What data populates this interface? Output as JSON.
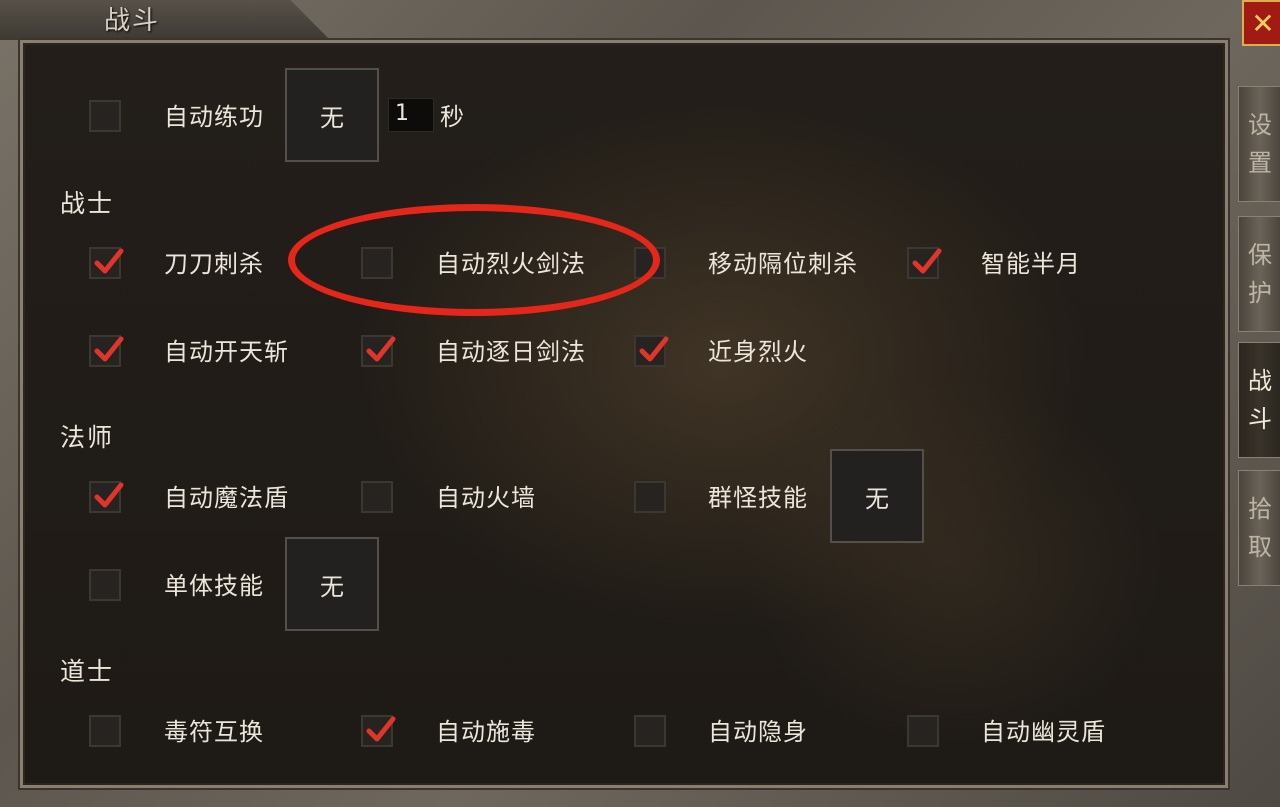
{
  "window": {
    "title": "战斗",
    "close_icon": "✕"
  },
  "side_tabs": [
    {
      "label": "设置",
      "chars": [
        "设",
        "置"
      ],
      "active": false
    },
    {
      "label": "保护",
      "chars": [
        "保",
        "护"
      ],
      "active": false
    },
    {
      "label": "战斗",
      "chars": [
        "战",
        "斗"
      ],
      "active": true
    },
    {
      "label": "拾取",
      "chars": [
        "拾",
        "取"
      ],
      "active": false
    }
  ],
  "auto_practice": {
    "label": "自动练功",
    "checked": false,
    "skill": "无",
    "seconds": "1",
    "unit": "秒"
  },
  "sections": {
    "warrior": "战士",
    "mage": "法师",
    "taoist": "道士"
  },
  "warrior": {
    "slash": {
      "label": "刀刀刺杀",
      "checked": true
    },
    "flaming_sword": {
      "label": "自动烈火剑法",
      "checked": false
    },
    "move_stab": {
      "label": "移动隔位刺杀",
      "checked": false
    },
    "half_moon": {
      "label": "智能半月",
      "checked": true
    },
    "sky_slash": {
      "label": "自动开天斩",
      "checked": true
    },
    "sun_chase": {
      "label": "自动逐日剑法",
      "checked": true
    },
    "close_flame": {
      "label": "近身烈火",
      "checked": true
    }
  },
  "mage": {
    "magic_shield": {
      "label": "自动魔法盾",
      "checked": true
    },
    "fire_wall": {
      "label": "自动火墙",
      "checked": false
    },
    "group_skill": {
      "label": "群怪技能",
      "checked": false,
      "skill": "无"
    },
    "single_skill": {
      "label": "单体技能",
      "checked": false,
      "skill": "无"
    }
  },
  "taoist": {
    "swap_talisman": {
      "label": "毒符互换",
      "checked": false
    },
    "auto_poison": {
      "label": "自动施毒",
      "checked": true
    },
    "auto_invisible": {
      "label": "自动隐身",
      "checked": false
    },
    "ghost_shield": {
      "label": "自动幽灵盾",
      "checked": false
    }
  },
  "colors": {
    "tick": "#e0352a",
    "annotation": "#e4271a",
    "close_bg": "#a11b14"
  }
}
